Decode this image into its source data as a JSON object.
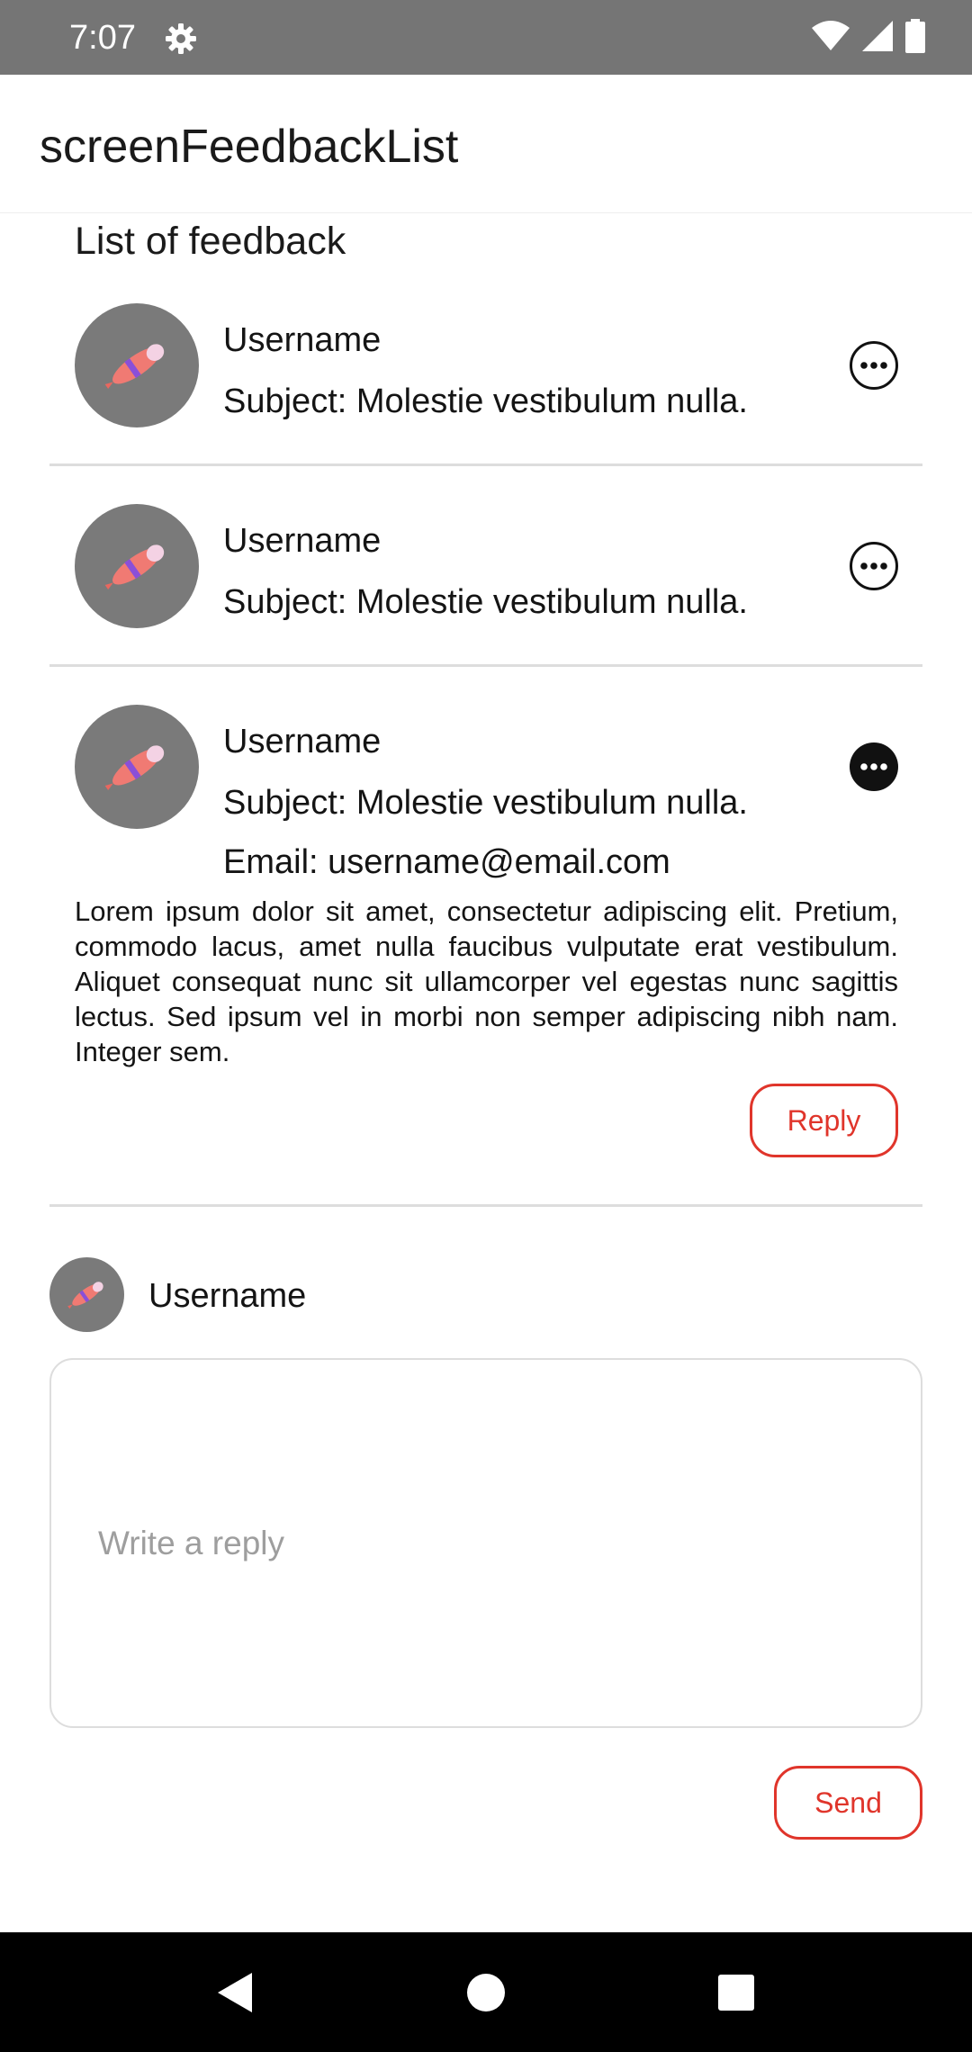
{
  "status_bar": {
    "time": "7:07",
    "settings_icon": "gear-icon",
    "wifi_icon": "wifi-icon",
    "signal_icon": "signal-icon",
    "battery_icon": "battery-icon"
  },
  "app_bar": {
    "title": "screenFeedbackList"
  },
  "list": {
    "title": "List of feedback",
    "items": [
      {
        "username": "Username",
        "subject": "Subject: Molestie vestibulum nulla.",
        "expanded": false
      },
      {
        "username": "Username",
        "subject": "Subject: Molestie vestibulum nulla.",
        "expanded": false
      },
      {
        "username": "Username",
        "subject": "Subject: Molestie vestibulum nulla.",
        "email": "Email: username@email.com",
        "body": "Lorem ipsum dolor sit amet, consectetur adipiscing elit. Pretium, commodo lacus, amet nulla faucibus vulputate erat vestibulum. Aliquet consequat nunc sit ullamcorper vel egestas nunc sagittis lectus. Sed ipsum vel in morbi non semper adipiscing nibh nam. Integer sem.",
        "reply_label": "Reply",
        "expanded": true
      }
    ]
  },
  "reply": {
    "username": "Username",
    "placeholder": "Write a reply",
    "send_label": "Send"
  },
  "colors": {
    "accent": "#e0352b",
    "status_bar": "#757575",
    "avatar_bg": "#7a7a7a"
  }
}
